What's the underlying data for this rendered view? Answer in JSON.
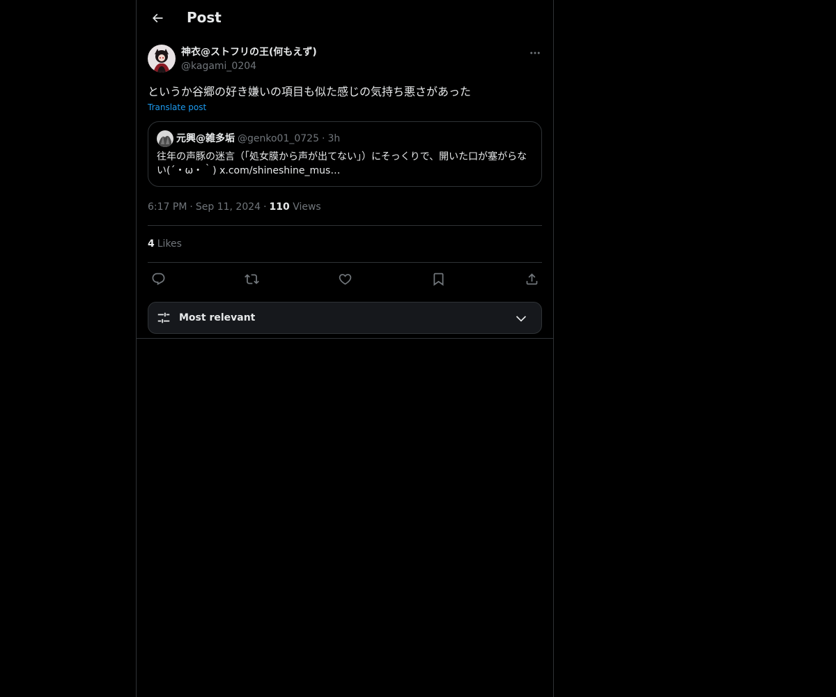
{
  "header": {
    "title": "Post"
  },
  "post": {
    "author": {
      "display_name": "神衣@ストフリの王(何もえず)",
      "handle": "@kagami_0204"
    },
    "text": "というか谷郷の好き嫌いの項目も似た感じの気持ち悪さがあった",
    "translate_label": "Translate post",
    "quote": {
      "display_name": "元興@雑多垢",
      "handle": "@genko01_0725",
      "separator": "·",
      "time": "3h",
      "text": "往年の声豚の迷言（「処女膜から声が出てない」）にそっくりで、開いた口が塞がらない(´・ω・｀) x.com/shineshine_mus…"
    },
    "meta": {
      "time": "6:17 PM",
      "separator": "·",
      "date": "Sep 11, 2024",
      "views_count": "110",
      "views_label": "Views"
    },
    "likes": {
      "count": "4",
      "label": "Likes"
    }
  },
  "sort": {
    "label": "Most relevant"
  },
  "colors": {
    "background": "#000000",
    "text": "#e7e9ea",
    "secondary_text": "#71767b",
    "accent": "#1d9bf0",
    "border": "#2f3336"
  },
  "icons": {
    "back": "arrow-left-icon",
    "more": "more-horizontal-icon",
    "reply": "reply-icon",
    "repost": "repost-icon",
    "like": "heart-icon",
    "bookmark": "bookmark-icon",
    "share": "share-icon",
    "sort": "sliders-icon",
    "chevron": "chevron-down-icon"
  }
}
